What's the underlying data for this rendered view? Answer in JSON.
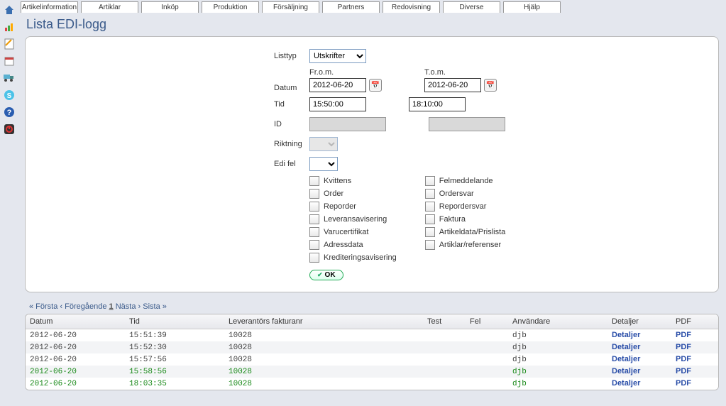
{
  "menu": [
    "Artikelinformation",
    "Artiklar",
    "Inköp",
    "Produktion",
    "Försäljning",
    "Partners",
    "Redovisning",
    "Diverse",
    "Hjälp"
  ],
  "title": "Lista EDI-logg",
  "form": {
    "listtyp_label": "Listtyp",
    "listtyp_value": "Utskrifter",
    "datum_label": "Datum",
    "from_caption": "Fr.o.m.",
    "to_caption": "T.o.m.",
    "date_from": "2012-06-20",
    "date_to": "2012-06-20",
    "tid_label": "Tid",
    "time_from": "15:50:00",
    "time_to": "18:10:00",
    "id_label": "ID",
    "riktning_label": "Riktning",
    "edifel_label": "Edi fel",
    "checks_left": [
      "Kvittens",
      "Order",
      "Reporder",
      "Leveransavisering",
      "Varucertifikat",
      "Adressdata",
      "Krediteringsavisering"
    ],
    "checks_right": [
      "Felmeddelande",
      "Ordersvar",
      "Repordersvar",
      "Faktura",
      "Artikeldata/Prislista",
      "Artiklar/referenser"
    ],
    "ok": "OK"
  },
  "pager": {
    "first": "« Första",
    "prev": "‹ Föregående",
    "cur": "1",
    "next": "Nästa ›",
    "last": "Sista »"
  },
  "table": {
    "cols": [
      "Datum",
      "Tid",
      "Leverantörs fakturanr",
      "Test",
      "Fel",
      "Användare",
      "Detaljer",
      "PDF"
    ],
    "rows": [
      {
        "datum": "2012-06-20",
        "tid": "15:51:39",
        "fakt": "10028",
        "test": "",
        "fel": "",
        "anv": "djb",
        "det": "Detaljer",
        "pdf": "PDF",
        "green": false
      },
      {
        "datum": "2012-06-20",
        "tid": "15:52:30",
        "fakt": "10028",
        "test": "",
        "fel": "",
        "anv": "djb",
        "det": "Detaljer",
        "pdf": "PDF",
        "green": false
      },
      {
        "datum": "2012-06-20",
        "tid": "15:57:56",
        "fakt": "10028",
        "test": "",
        "fel": "",
        "anv": "djb",
        "det": "Detaljer",
        "pdf": "PDF",
        "green": false
      },
      {
        "datum": "2012-06-20",
        "tid": "15:58:56",
        "fakt": "10028",
        "test": "",
        "fel": "",
        "anv": "djb",
        "det": "Detaljer",
        "pdf": "PDF",
        "green": true
      },
      {
        "datum": "2012-06-20",
        "tid": "18:03:35",
        "fakt": "10028",
        "test": "",
        "fel": "",
        "anv": "djb",
        "det": "Detaljer",
        "pdf": "PDF",
        "green": true
      }
    ]
  }
}
